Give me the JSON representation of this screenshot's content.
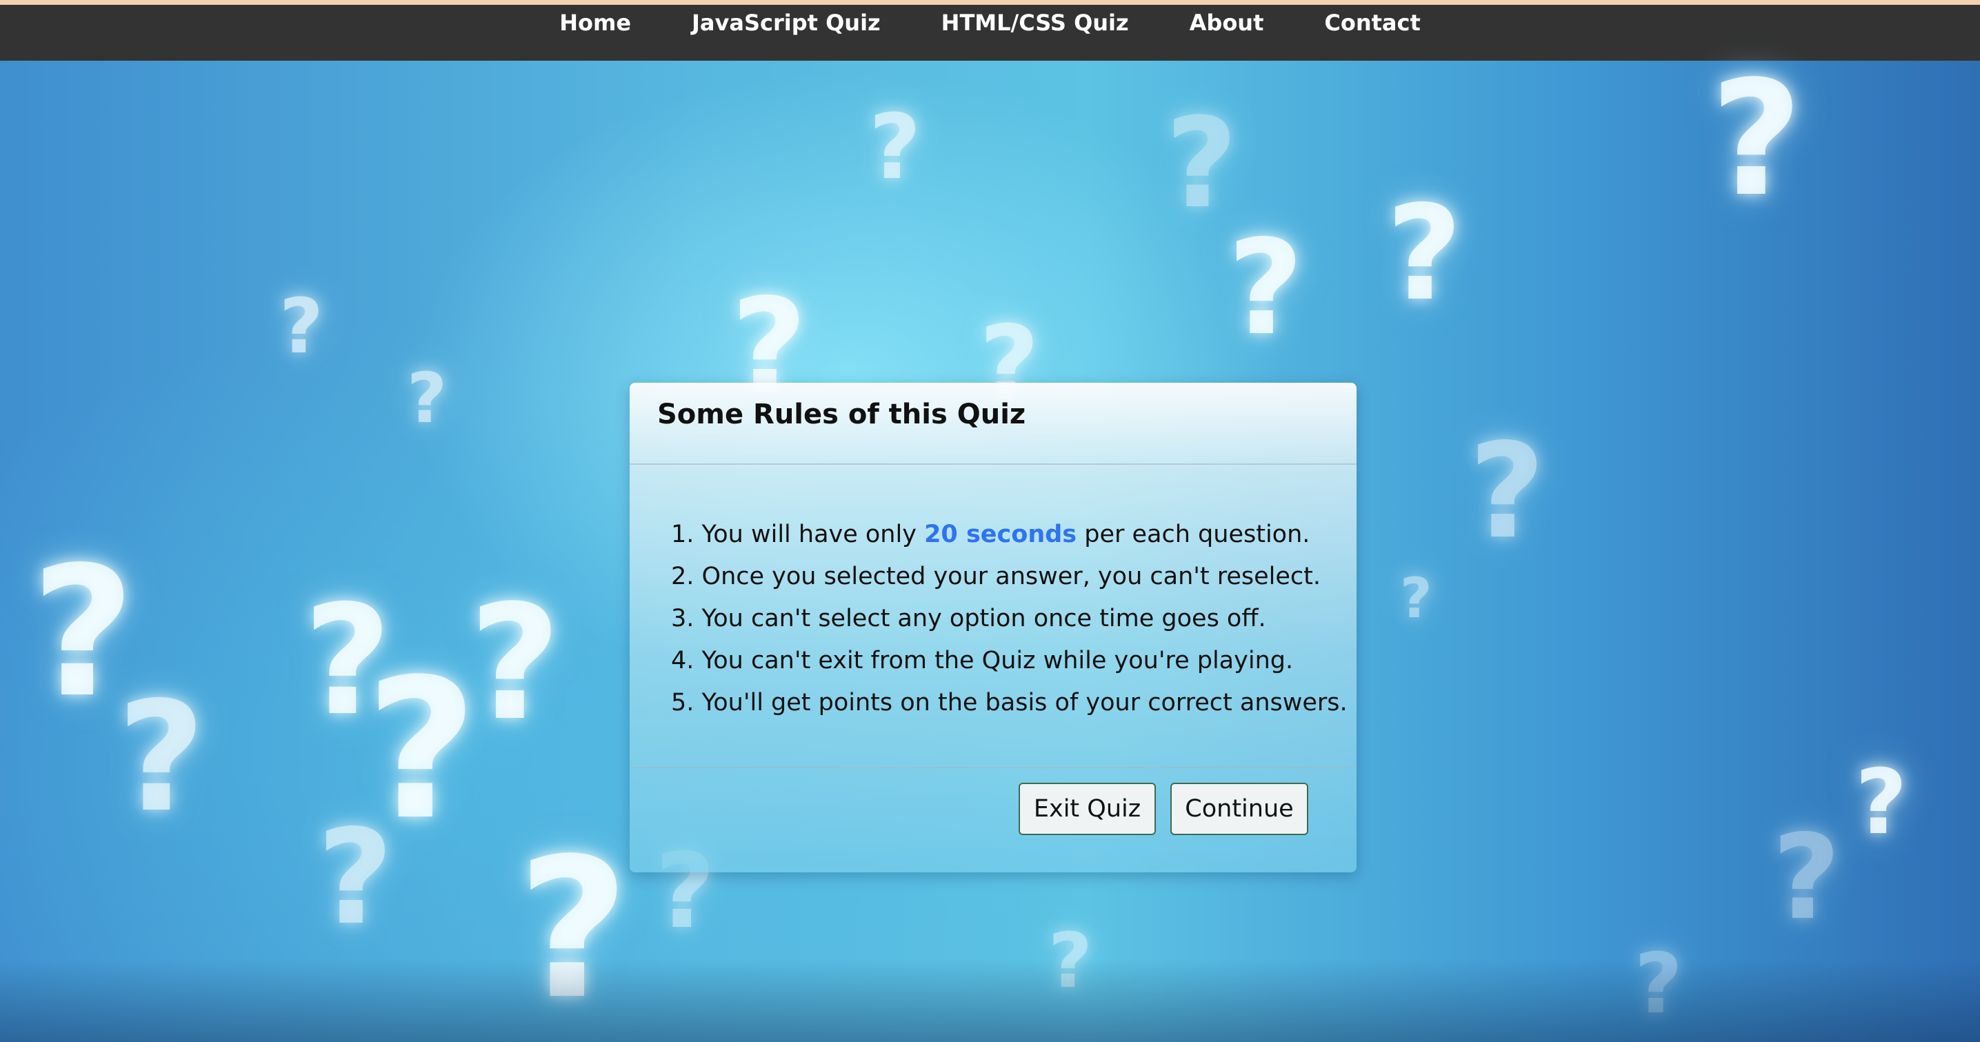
{
  "colors": {
    "navbar_bg": "#333333",
    "top_accent": "#f3d2b2",
    "highlight": "#2f73f0",
    "background_blue": "#4fb0da"
  },
  "nav": {
    "items": [
      {
        "label": "Home"
      },
      {
        "label": "JavaScript Quiz"
      },
      {
        "label": "HTML/CSS Quiz"
      },
      {
        "label": "About"
      },
      {
        "label": "Contact"
      }
    ]
  },
  "background": {
    "decoration": "question marks",
    "glyph": "?"
  },
  "modal": {
    "title": "Some Rules of this Quiz",
    "rules": [
      {
        "prefix": "1. You will have only ",
        "highlight": "20 seconds",
        "suffix": " per each question."
      },
      {
        "text": "2. Once you selected your answer, you can't reselect."
      },
      {
        "text": "3. You can't select any option once time goes off."
      },
      {
        "text": "4. You can't exit from the Quiz while you're playing."
      },
      {
        "text": "5. You'll get points on the basis of your correct answers."
      }
    ],
    "buttons": {
      "exit_label": "Exit Quiz",
      "continue_label": "Continue"
    }
  }
}
